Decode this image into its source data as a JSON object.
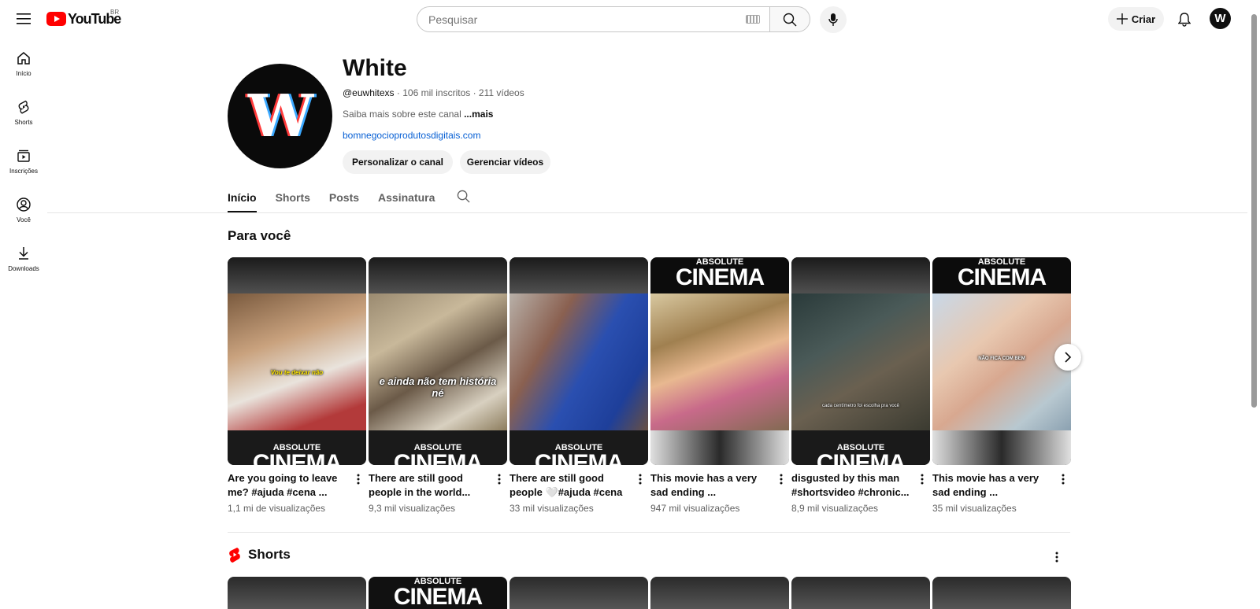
{
  "header": {
    "logo_text": "YouTube",
    "country": "BR",
    "search_placeholder": "Pesquisar",
    "create_label": "Criar",
    "avatar_letter": "W"
  },
  "sidebar": {
    "items": [
      {
        "label": "Início",
        "icon": "home-icon"
      },
      {
        "label": "Shorts",
        "icon": "shorts-icon"
      },
      {
        "label": "Inscrições",
        "icon": "subscriptions-icon"
      },
      {
        "label": "Você",
        "icon": "account-icon"
      },
      {
        "label": "Downloads",
        "icon": "download-icon"
      }
    ]
  },
  "channel": {
    "avatar_letter": "W",
    "name": "White",
    "handle": "@euwhitexs",
    "subscribers": "· 106 mil inscritos · 211 vídeos",
    "description": "Saiba mais sobre este canal",
    "more": "...mais",
    "link": "bomnegocioprodutosdigitais.com",
    "buttons": {
      "customize": "Personalizar o canal",
      "manage": "Gerenciar vídeos"
    }
  },
  "tabs": [
    {
      "label": "Início",
      "active": true
    },
    {
      "label": "Shorts",
      "active": false
    },
    {
      "label": "Posts",
      "active": false
    },
    {
      "label": "Assinatura",
      "active": false
    }
  ],
  "for_you": {
    "title": "Para você",
    "videos": [
      {
        "title": "Are you going to leave me? #ajuda #cena ...",
        "views": "1,1 mi de visualizações",
        "brand_position": "bottom",
        "caption": "Vou te deixar não"
      },
      {
        "title": "There are still good people in the world...",
        "views": "9,3 mil visualizações",
        "brand_position": "bottom",
        "caption": "e ainda não tem história né"
      },
      {
        "title": "There are still good people 🤍#ajuda #cena ...",
        "views": "33 mil visualizações",
        "brand_position": "bottom",
        "caption": ""
      },
      {
        "title": "This movie has a very sad ending ...",
        "views": "947 mil visualizações",
        "brand_position": "top",
        "caption": ""
      },
      {
        "title": "disgusted by this man #shortsvideo #chronic...",
        "views": "8,9 mil visualizações",
        "brand_position": "bottom",
        "caption": "cada centímetro foi escolha pra você"
      },
      {
        "title": "This movie has a very sad ending ...",
        "views": "35 mil visualizações",
        "brand_position": "top",
        "caption": "NÃO FICA COM BEM"
      }
    ],
    "brand_small": "ABSOLUTE",
    "brand_large": "CINEMA"
  },
  "shorts_section": {
    "title": "Shorts",
    "brand_small": "ABSOLUTE",
    "brand_large": "CINEMA"
  },
  "colors": {
    "accent_red": "#ff0000",
    "link_blue": "#065fd4",
    "text_secondary": "#606060"
  }
}
